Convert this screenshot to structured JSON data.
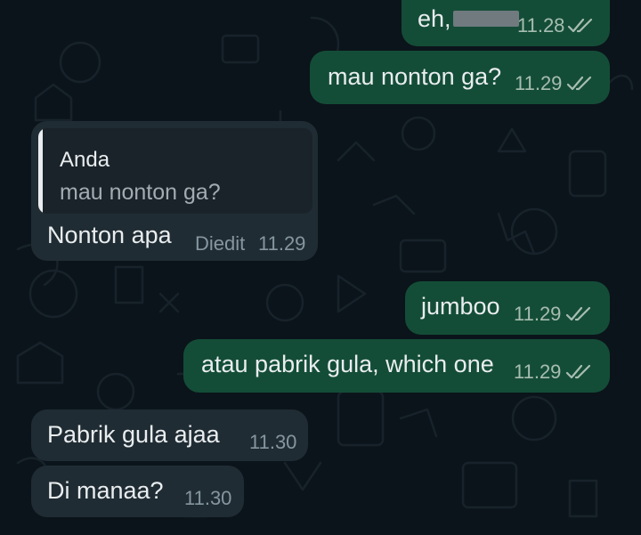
{
  "chat": {
    "messages": [
      {
        "direction": "out",
        "text_prefix": "eh,",
        "redacted": true,
        "time": "11.28",
        "status": "read"
      },
      {
        "direction": "out",
        "text": "mau nonton ga?",
        "time": "11.29",
        "status": "read"
      },
      {
        "direction": "in",
        "quote": {
          "author": "Anda",
          "text": "mau nonton ga?"
        },
        "text": "Nonton apa",
        "edited_label": "Diedit",
        "time": "11.29"
      },
      {
        "direction": "out",
        "text": "jumboo",
        "time": "11.29",
        "status": "read"
      },
      {
        "direction": "out",
        "text": "atau pabrik gula, which one",
        "time": "11.29",
        "status": "read"
      },
      {
        "direction": "in",
        "text": "Pabrik gula ajaa",
        "time": "11.30"
      },
      {
        "direction": "in",
        "text": "Di manaa?",
        "time": "11.30"
      }
    ]
  },
  "colors": {
    "background": "#0b141a",
    "outgoing_bubble": "#144d37",
    "incoming_bubble": "#202c33",
    "read_ticks": "#a7bdb2"
  },
  "icons": {
    "read_receipt": "double-check-icon",
    "quote_indicator": "quote-bar"
  }
}
